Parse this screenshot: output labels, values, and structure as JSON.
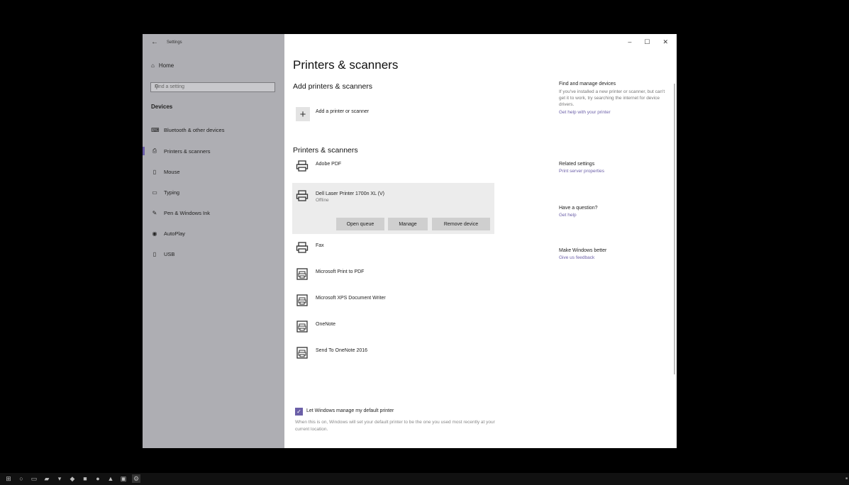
{
  "window": {
    "title": "Settings"
  },
  "sidebar": {
    "home_label": "Home",
    "search_placeholder": "Find a setting",
    "section_label": "Devices",
    "items": [
      {
        "label": "Bluetooth & other devices",
        "icon": "keyboard-icon"
      },
      {
        "label": "Printers & scanners",
        "icon": "printer-icon",
        "active": true
      },
      {
        "label": "Mouse",
        "icon": "mouse-icon"
      },
      {
        "label": "Typing",
        "icon": "keyboard-typing-icon"
      },
      {
        "label": "Pen & Windows Ink",
        "icon": "pen-icon"
      },
      {
        "label": "AutoPlay",
        "icon": "autoplay-icon"
      },
      {
        "label": "USB",
        "icon": "usb-icon"
      }
    ]
  },
  "main": {
    "page_title": "Printers & scanners",
    "add_section_title": "Add printers & scanners",
    "add_label": "Add a printer or scanner",
    "list_title": "Printers & scanners",
    "printers": [
      {
        "name": "Adobe PDF",
        "icon": "printer-icon"
      },
      {
        "name": "Dell Laser Printer 1700n XL (V)",
        "status": "Offline",
        "icon": "printer-icon",
        "selected": true
      },
      {
        "name": "Fax",
        "icon": "fax-icon"
      },
      {
        "name": "Microsoft Print to PDF",
        "icon": "printer-doc-icon"
      },
      {
        "name": "Microsoft XPS Document Writer",
        "icon": "printer-doc-icon"
      },
      {
        "name": "OneNote",
        "icon": "printer-doc-icon"
      },
      {
        "name": "Send To OneNote 2016",
        "icon": "printer-doc-icon"
      }
    ],
    "buttons": {
      "open_queue": "Open queue",
      "manage": "Manage",
      "remove": "Remove device"
    },
    "default_printer": {
      "label": "Let Windows manage my default printer",
      "checked": true,
      "description": "When this is on, Windows will set your default printer to be the one you used most recently at your current location."
    }
  },
  "right_panel": {
    "find": {
      "title": "Find and manage devices",
      "text": "If you've installed a new printer or scanner, but can't get it to work, try searching the internet for device drivers.",
      "link": "Get help with your printer"
    },
    "related": {
      "title": "Related settings",
      "link": "Print server properties"
    },
    "question": {
      "title": "Have a question?",
      "link": "Get help"
    },
    "better": {
      "title": "Make Windows better",
      "link": "Give us feedback"
    }
  },
  "colors": {
    "accent": "#6b5fa8",
    "sidebar": "#aeaeb3"
  }
}
